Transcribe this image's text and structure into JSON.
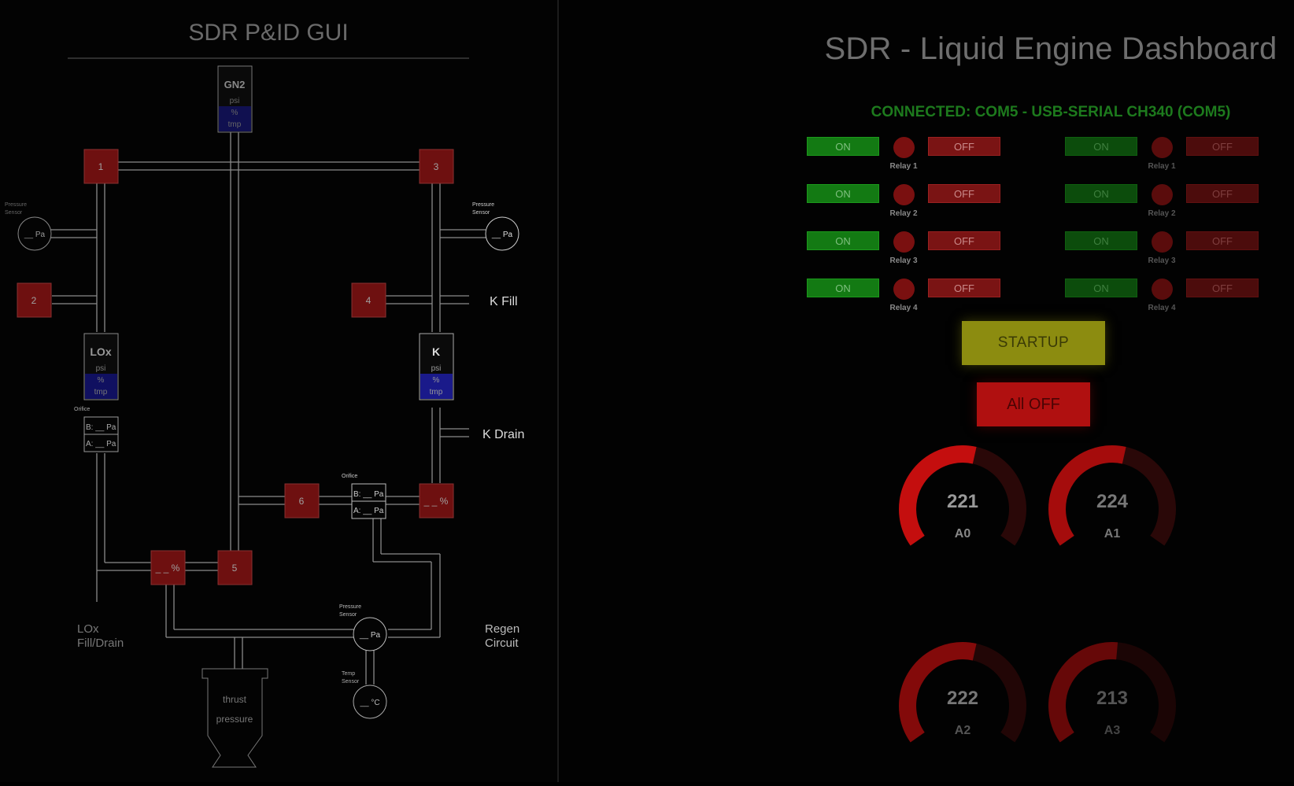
{
  "pid": {
    "title": "SDR P&ID GUI",
    "gn2": {
      "name": "GN2",
      "psi": "psi",
      "pct": "%",
      "tmp": "tmp"
    },
    "lox": {
      "name": "LOx",
      "psi": "psi",
      "pct": "%",
      "tmp": "tmp"
    },
    "k": {
      "name": "K",
      "psi": "psi",
      "pct": "%",
      "tmp": "tmp"
    },
    "valves": {
      "v1": "1",
      "v2": "2",
      "v3": "3",
      "v4": "4",
      "v5": "5",
      "v6": "6",
      "lox_main": "_ _ %",
      "k_main": "_ _ %"
    },
    "pressure_sensor_label": "Pressure Sensor",
    "temp_sensor_label": "Temp Sensor",
    "orifice_label": "Orifice",
    "pa_reading": "__ Pa",
    "temp_reading": "__ °C",
    "orifice_b": "B: __ Pa",
    "orifice_a": "A: __ Pa",
    "k_fill": "K Fill",
    "k_drain": "K Drain",
    "lox_fill_drain_1": "LOx",
    "lox_fill_drain_2": "Fill/Drain",
    "regen_1": "Regen",
    "regen_2": "Circuit",
    "thrust_1": "thrust",
    "thrust_2": "pressure"
  },
  "dashboard": {
    "title": "SDR - Liquid Engine Dashboard",
    "connection": "CONNECTED: COM5 - USB-SERIAL CH340 (COM5)",
    "on_label": "ON",
    "off_label": "OFF",
    "relay_groups": [
      {
        "relays": [
          "Relay 1",
          "Relay 2",
          "Relay 3",
          "Relay 4"
        ]
      },
      {
        "relays": [
          "Relay 1",
          "Relay 2",
          "Relay 3",
          "Relay 4"
        ]
      }
    ],
    "startup_label": "STARTUP",
    "alloff_label": "All OFF",
    "gauges": [
      {
        "value": "221",
        "label": "A0",
        "level": 0.55
      },
      {
        "value": "224",
        "label": "A1",
        "level": 0.55
      },
      {
        "value": "222",
        "label": "A2",
        "level": 0.55
      },
      {
        "value": "213",
        "label": "A3",
        "level": 0.52
      }
    ],
    "colors": {
      "on": "#137a13",
      "off": "#7a1414",
      "startup": "#8c8c10",
      "alloff": "#b01010",
      "gauge": "#c40e0e"
    }
  }
}
